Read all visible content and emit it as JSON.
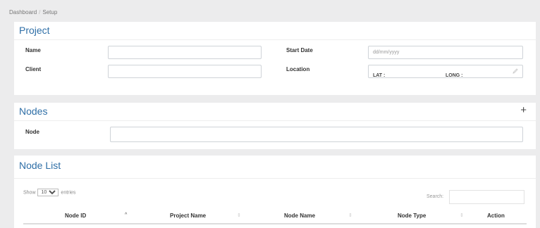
{
  "breadcrumb": {
    "items": [
      "Dashboard",
      "Setup"
    ]
  },
  "project": {
    "title": "Project",
    "name_label": "Name",
    "client_label": "Client",
    "start_date_label": "Start Date",
    "start_date_placeholder": "dd/mm/yyyy",
    "location_label": "Location",
    "lat_label": "LAT :",
    "long_label": "LONG :"
  },
  "nodes": {
    "title": "Nodes",
    "add_icon": "plus-icon",
    "node_label": "Node"
  },
  "node_list": {
    "title": "Node List",
    "show_label": "Show",
    "page_size": "10",
    "entries_label": "entries",
    "search_label": "Search:",
    "columns": [
      "Node ID",
      "Project Name",
      "Node Name",
      "Node Type",
      "Action"
    ]
  }
}
